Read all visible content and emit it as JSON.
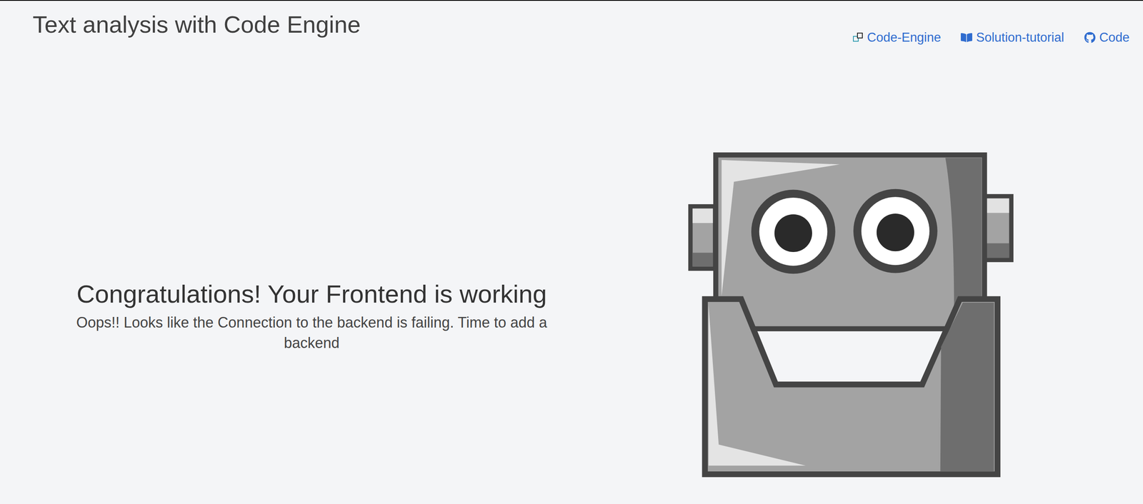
{
  "header": {
    "title": "Text analysis with Code Engine"
  },
  "nav": [
    {
      "label": "Code-Engine"
    },
    {
      "label": "Solution-tutorial"
    },
    {
      "label": "Code"
    }
  ],
  "status": {
    "heading": "Congratulations! Your Frontend is working",
    "message": "Oops!! Looks like the Connection to the backend is failing. Time to add a backend"
  }
}
